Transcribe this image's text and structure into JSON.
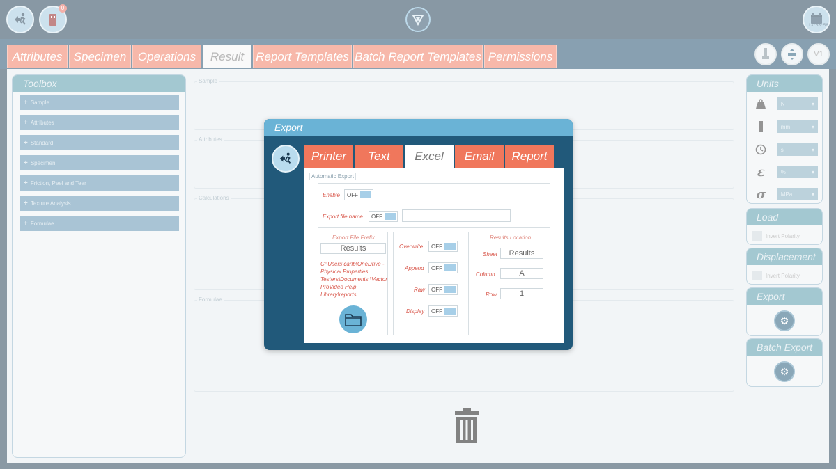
{
  "topbar": {
    "notification_count": "0",
    "clock_time": "13:58:56"
  },
  "tabs": [
    {
      "label": "Attributes"
    },
    {
      "label": "Specimen"
    },
    {
      "label": "Operations"
    },
    {
      "label": "Result"
    },
    {
      "label": "Report Templates"
    },
    {
      "label": "Batch Report Templates"
    },
    {
      "label": "Permissions"
    }
  ],
  "active_tab": "Result",
  "right_tools": {
    "version_label": "V1"
  },
  "toolbox": {
    "title": "Toolbox",
    "items": [
      "Sample",
      "Attributes",
      "Standard",
      "Specimen",
      "Friction, Peel and Tear",
      "Texture Analysis",
      "Formulae"
    ]
  },
  "sections": {
    "sample": "Sample",
    "attributes": "Attributes",
    "calculations": "Calculations",
    "formulae": "Formulae"
  },
  "units": {
    "title": "Units",
    "rows": [
      {
        "icon": "weight-icon",
        "value": "N"
      },
      {
        "icon": "ruler-icon",
        "value": "mm"
      },
      {
        "icon": "clock-icon",
        "value": "s"
      },
      {
        "icon": "epsilon-icon",
        "symbol": "ε",
        "value": "%"
      },
      {
        "icon": "sigma-icon",
        "symbol": "σ",
        "value": "MPa"
      }
    ]
  },
  "load": {
    "title": "Load",
    "invert_label": "Invert Polarity"
  },
  "displacement": {
    "title": "Displacement",
    "invert_label": "Invert Polarity"
  },
  "export_panel": {
    "title": "Export"
  },
  "batch_export_panel": {
    "title": "Batch Export"
  },
  "dialog": {
    "title": "Export",
    "tabs": [
      "Printer",
      "Text",
      "Excel",
      "Email",
      "Report"
    ],
    "active_tab": "Excel",
    "automatic_export": {
      "legend": "Automatic Export",
      "enable_label": "Enable",
      "enable_state": "OFF",
      "file_name_label": "Export file name",
      "file_name_state": "OFF",
      "file_name_value": ""
    },
    "prefix": {
      "legend": "Export File Prefix",
      "value": "Results",
      "path": "C:\\Users\\carlb\\OneDrive - Physical Properties Testers\\Documents \\Vector ProVideo Help Library\\reports"
    },
    "options": [
      {
        "label": "Overwrite",
        "state": "OFF"
      },
      {
        "label": "Append",
        "state": "OFF"
      },
      {
        "label": "Raw",
        "state": "OFF"
      },
      {
        "label": "Display",
        "state": "OFF"
      }
    ],
    "results_location": {
      "legend": "Results Location",
      "sheet_label": "Sheet",
      "sheet_value": "Results",
      "column_label": "Column",
      "column_value": "A",
      "row_label": "Row",
      "row_value": "1"
    }
  }
}
